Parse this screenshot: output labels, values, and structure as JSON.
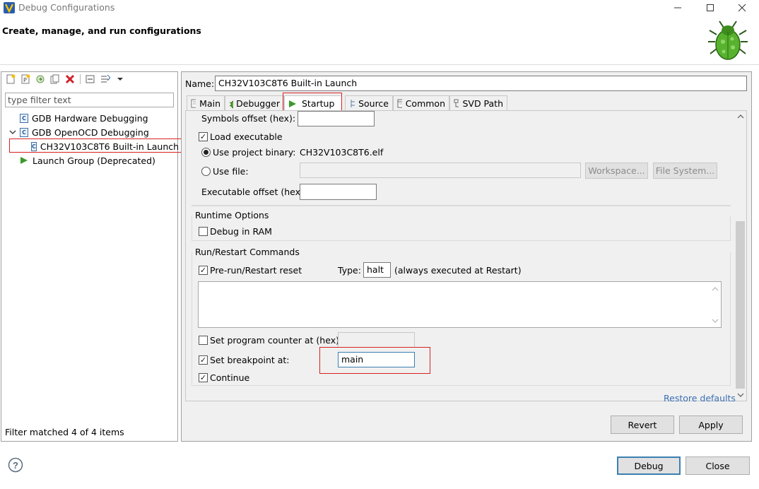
{
  "window": {
    "title": "Debug Configurations",
    "header": "Create, manage, and run configurations"
  },
  "left": {
    "filter_placeholder": "type filter text",
    "tree": [
      {
        "label": "GDB Hardware Debugging"
      },
      {
        "label": "GDB OpenOCD Debugging"
      },
      {
        "label": "CH32V103C8T6 Built-in Launch"
      },
      {
        "label": "Launch Group (Deprecated)"
      }
    ],
    "status": "Filter matched 4 of 4 items"
  },
  "right": {
    "name_label": "Name:",
    "name_value": "CH32V103C8T6 Built-in Launch",
    "tabs": [
      {
        "label": "Main"
      },
      {
        "label": "Debugger"
      },
      {
        "label": "Startup"
      },
      {
        "label": "Source"
      },
      {
        "label": "Common"
      },
      {
        "label": "SVD Path"
      }
    ],
    "startup": {
      "symbols_offset_label": "Symbols offset (hex):",
      "load_executable_label": "Load executable",
      "use_project_binary_label": "Use project binary:",
      "project_binary_value": "CH32V103C8T6.elf",
      "use_file_label": "Use file:",
      "workspace_button": "Workspace...",
      "file_system_button": "File System...",
      "executable_offset_label": "Executable offset (hex):",
      "runtime_options_title": "Runtime Options",
      "debug_in_ram_label": "Debug in RAM",
      "run_restart_title": "Run/Restart Commands",
      "pre_run_label": "Pre-run/Restart reset",
      "type_label": "Type:",
      "type_value": "halt",
      "type_note": "(always executed at Restart)",
      "set_pc_label": "Set program counter at (hex):",
      "set_breakpoint_label": "Set breakpoint at:",
      "breakpoint_value": "main",
      "continue_label": "Continue",
      "restore_defaults": "Restore defaults"
    },
    "revert_button": "Revert",
    "apply_button": "Apply"
  },
  "footer": {
    "debug_button": "Debug",
    "close_button": "Close"
  }
}
